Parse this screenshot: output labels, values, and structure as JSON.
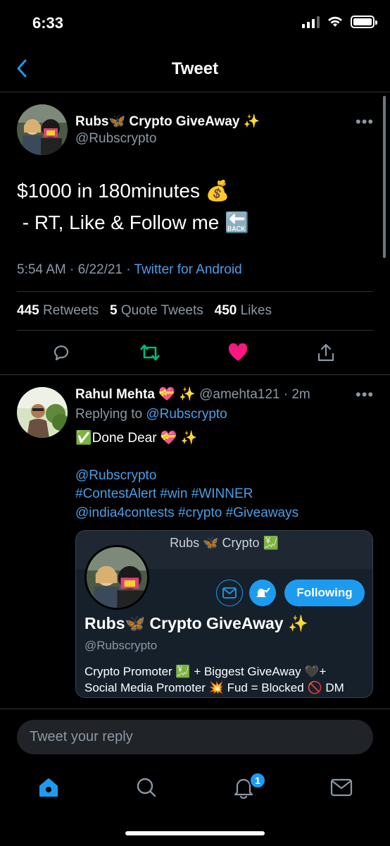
{
  "status_bar": {
    "time": "6:33"
  },
  "nav": {
    "title": "Tweet"
  },
  "tweet": {
    "display_name": "Rubs🦋 Crypto GiveAway ✨",
    "handle": "@Rubscrypto",
    "text_line1": "$1000 in 180minutes 💰",
    "text_line2": " - RT, Like & Follow me 🔙",
    "timestamp": "5:54 AM · 6/22/21 · ",
    "source": "Twitter for Android",
    "retweets_count": "445",
    "retweets_label": "Retweets",
    "quotes_count": "5",
    "quotes_label": "Quote Tweets",
    "likes_count": "450",
    "likes_label": "Likes"
  },
  "reply": {
    "display_name": "Rahul Mehta 💝 ✨",
    "handle_time": "@amehta121 · 2m",
    "replying_to_prefix": "Replying to ",
    "replying_to_handle": "@Rubscrypto",
    "text": "✅Done Dear 💝 ✨",
    "mention": "@Rubscrypto",
    "hashtags_line1": "#ContestAlert #win #WINNER",
    "hashtags_line2": "@india4contests #crypto #Giveaways"
  },
  "profile_card": {
    "header_title": "Rubs 🦋 Crypto 💹",
    "following_label": "Following",
    "display_name": "Rubs🦋 Crypto GiveAway ✨",
    "handle": "@Rubscrypto",
    "bio_line1": "Crypto Promoter 💹 + Biggest GiveAway 🖤+",
    "bio_line2": "Social Media Promoter 💥  Fud = Blocked 🚫 DM"
  },
  "composer": {
    "placeholder": "Tweet your reply"
  },
  "tab_bar": {
    "notifications_badge": "1"
  },
  "colors": {
    "accent": "#1d9bf0",
    "like": "#f91880",
    "retweet": "#00ba7c",
    "background": "#000000"
  }
}
